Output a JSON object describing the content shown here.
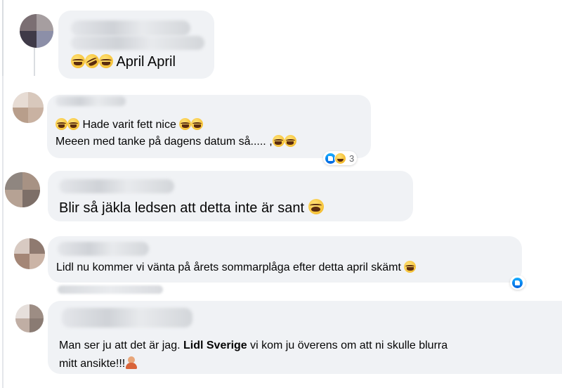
{
  "comments": [
    {
      "text_parts": [
        {
          "emoji": "laugh-cry"
        },
        {
          "emoji": "rolling-laugh"
        },
        {
          "emoji": "laugh-cry"
        },
        {
          "text": " April April"
        }
      ]
    },
    {
      "line1": "Hade varit fett nice",
      "line2": "Meeen med tanke på dagens datum så..... ,",
      "reaction_count": "3"
    },
    {
      "text": "Blir så jäkla ledsen att detta inte är sant"
    },
    {
      "text": "Lidl nu kommer vi vänta på årets sommarplåga efter detta april skämt"
    },
    {
      "line1_prefix": "Man ser ju att det är jag. ",
      "line1_mention": "Lidl Sverige",
      "line1_suffix": " vi kom ju överens om att ni skulle blurra",
      "line2": "mitt ansikte!!!"
    }
  ],
  "colors": {
    "bubble": "#f0f2f5",
    "text": "#050505",
    "thread_line": "#dadde1",
    "like_blue": "#0866ff",
    "meta_grey": "#65676b"
  },
  "icons": [
    "laugh-cry-emoji",
    "rolling-laugh-emoji",
    "crying-emoji",
    "person-shrugging-emoji",
    "like-reaction-icon",
    "haha-reaction-icon"
  ]
}
